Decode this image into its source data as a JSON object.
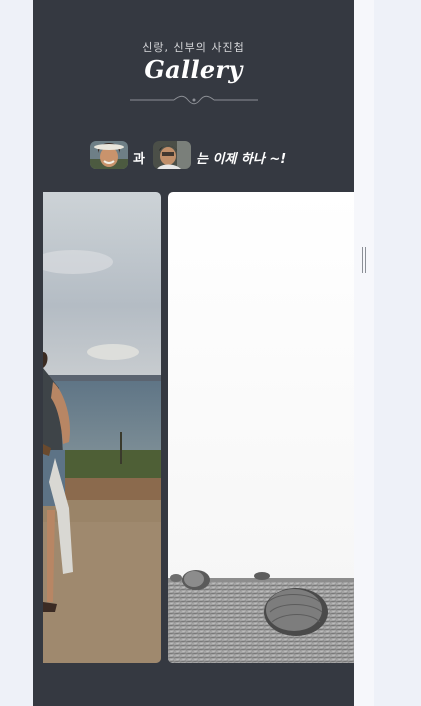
{
  "gallery": {
    "subtitle": "신랑, 신부의 사진첩",
    "title": "Gallery",
    "connector": "과",
    "tagline": "는 이제 하나 ~!"
  },
  "icons": {
    "ornament": "flourish-divider-icon",
    "bride_avatar": "bride-photo",
    "groom_avatar": "groom-photo"
  },
  "photos": [
    {
      "name": "seaside-couple-photo"
    },
    {
      "name": "hay-bales-field-photo"
    }
  ],
  "colors": {
    "page_bg": "#353941",
    "outer_bg": "#eef1f8",
    "text": "#ffffff"
  }
}
